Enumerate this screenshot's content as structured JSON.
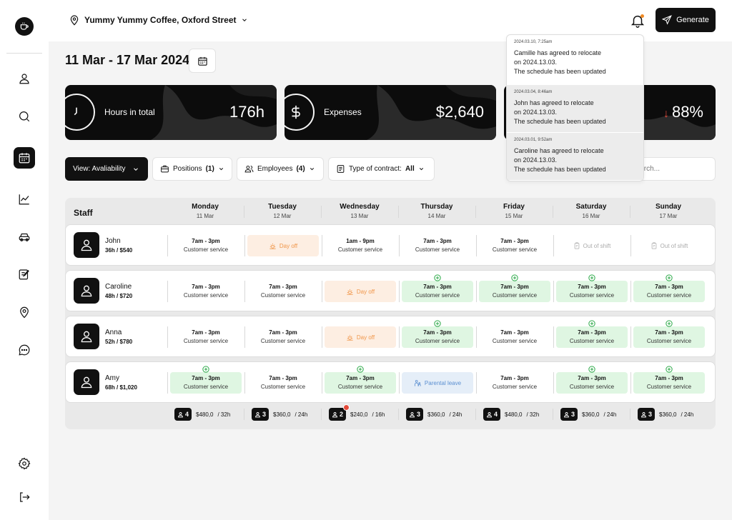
{
  "header": {
    "location": "Yummy Yummy Coffee, Oxford Street",
    "generate_label": "Generate"
  },
  "date_range": "11 Mar - 17 Mar 2024",
  "stats": [
    {
      "label": "Hours in total",
      "value": "176h"
    },
    {
      "label": "Expenses",
      "value": "$2,640"
    },
    {
      "label": "",
      "value": "88%",
      "trend": "down"
    }
  ],
  "filters": {
    "view": "View: Avaliability",
    "positions_label": "Positions",
    "positions_count": "(1)",
    "employees_label": "Employees",
    "employees_count": "(4)",
    "contract_label": "Type of contract:",
    "contract_value": "All",
    "search_placeholder": "Search..."
  },
  "schedule": {
    "staff_header": "Staff",
    "days": [
      {
        "name": "Monday",
        "date": "11 Mar"
      },
      {
        "name": "Tuesday",
        "date": "12 Mar"
      },
      {
        "name": "Wednesday",
        "date": "13 Mar"
      },
      {
        "name": "Thursday",
        "date": "14 Mar"
      },
      {
        "name": "Friday",
        "date": "15 Mar"
      },
      {
        "name": "Saturday",
        "date": "16 Mar"
      },
      {
        "name": "Sunday",
        "date": "17 Mar"
      }
    ],
    "employees": [
      {
        "name": "John",
        "summary": "36h / $540",
        "shifts": [
          {
            "type": "shift",
            "time": "7am - 3pm",
            "role": "Customer service"
          },
          {
            "type": "dayoff",
            "label": "Day off"
          },
          {
            "type": "shift",
            "time": "1am - 9pm",
            "role": "Customer service"
          },
          {
            "type": "shift",
            "time": "7am - 3pm",
            "role": "Customer service"
          },
          {
            "type": "shift",
            "time": "7am - 3pm",
            "role": "Customer service"
          },
          {
            "type": "oos",
            "label": "Out of shift"
          },
          {
            "type": "oos",
            "label": "Out of shift"
          }
        ]
      },
      {
        "name": "Caroline",
        "summary": "48h / $720",
        "shifts": [
          {
            "type": "shift",
            "time": "7am - 3pm",
            "role": "Customer service"
          },
          {
            "type": "shift",
            "time": "7am - 3pm",
            "role": "Customer service"
          },
          {
            "type": "dayoff",
            "label": "Day off"
          },
          {
            "type": "added",
            "time": "7am - 3pm",
            "role": "Customer service"
          },
          {
            "type": "added",
            "time": "7am - 3pm",
            "role": "Customer service"
          },
          {
            "type": "added",
            "time": "7am - 3pm",
            "role": "Customer service"
          },
          {
            "type": "added",
            "time": "7am - 3pm",
            "role": "Customer service"
          }
        ]
      },
      {
        "name": "Anna",
        "summary": "52h / $780",
        "shifts": [
          {
            "type": "shift",
            "time": "7am - 3pm",
            "role": "Customer service"
          },
          {
            "type": "shift",
            "time": "7am - 3pm",
            "role": "Customer service"
          },
          {
            "type": "dayoff",
            "label": "Day off"
          },
          {
            "type": "added",
            "time": "7am - 3pm",
            "role": "Customer service"
          },
          {
            "type": "shift",
            "time": "7am - 3pm",
            "role": "Customer service"
          },
          {
            "type": "added",
            "time": "7am - 3pm",
            "role": "Customer service"
          },
          {
            "type": "added",
            "time": "7am - 3pm",
            "role": "Customer service"
          }
        ]
      },
      {
        "name": "Amy",
        "summary": "68h / $1,020",
        "shifts": [
          {
            "type": "added",
            "time": "7am - 3pm",
            "role": "Customer service"
          },
          {
            "type": "shift",
            "time": "7am - 3pm",
            "role": "Customer service"
          },
          {
            "type": "added",
            "time": "7am - 3pm",
            "role": "Customer service"
          },
          {
            "type": "parental",
            "label": "Parental leave"
          },
          {
            "type": "shift",
            "time": "7am - 3pm",
            "role": "Customer service"
          },
          {
            "type": "added",
            "time": "7am - 3pm",
            "role": "Customer service"
          },
          {
            "type": "added",
            "time": "7am - 3pm",
            "role": "Customer service"
          }
        ]
      }
    ],
    "totals": [
      {
        "count": "4",
        "amount": "$480,0",
        "hours": "/ 32h",
        "alert": false
      },
      {
        "count": "3",
        "amount": "$360,0",
        "hours": "/ 24h",
        "alert": false
      },
      {
        "count": "2",
        "amount": "$240,0",
        "hours": "/ 16h",
        "alert": true
      },
      {
        "count": "3",
        "amount": "$360,0",
        "hours": "/ 24h",
        "alert": false
      },
      {
        "count": "4",
        "amount": "$480,0",
        "hours": "/ 32h",
        "alert": false
      },
      {
        "count": "3",
        "amount": "$360,0",
        "hours": "/ 24h",
        "alert": false
      },
      {
        "count": "3",
        "amount": "$360,0",
        "hours": "/ 24h",
        "alert": false
      }
    ]
  },
  "notifications": [
    {
      "date": "2024.03.10, 7:25am",
      "l1": "Camille has agreed to relocate",
      "l2": "on 2024.13.03.",
      "l3": "The schedule has been updated"
    },
    {
      "date": "2024.03.04, 8:46am",
      "l1": "John has agreed to relocate",
      "l2": "on 2024.13.03.",
      "l3": "The schedule has been updated"
    },
    {
      "date": "2024.03.01, 9:52am",
      "l1": "Caroline has agreed to relocate",
      "l2": "on 2024.13.03.",
      "l3": "The schedule has been updated"
    }
  ],
  "icons": {
    "sidebar": [
      "user-icon",
      "search-icon",
      "calendar-icon",
      "chart-icon",
      "car-icon",
      "edit-icon",
      "map-pin-icon",
      "chat-icon",
      "settings-icon",
      "logout-icon"
    ]
  },
  "colors": {
    "accent": "#111111",
    "added_shift_bg": "#dff6e2",
    "day_off_bg": "#fdeee2",
    "parental_bg": "#e5eef8",
    "alert": "#e34b3b",
    "notification_dot": "#f08a24"
  }
}
